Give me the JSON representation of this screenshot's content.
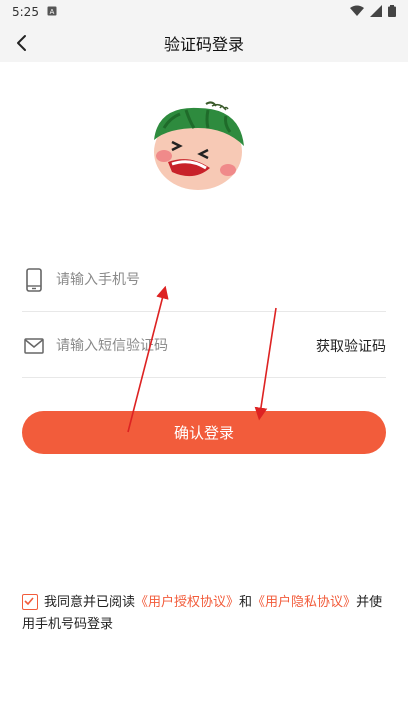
{
  "status_bar": {
    "time": "5:25",
    "notification_icon": "a-icon",
    "wifi_icon": "wifi-icon",
    "signal_icon": "signal-icon",
    "battery_icon": "battery-icon"
  },
  "app_bar": {
    "back_icon": "chevron-left-icon",
    "title": "验证码登录"
  },
  "avatar": {
    "icon": "watermelon-face-icon"
  },
  "phone_field": {
    "icon": "phone-icon",
    "placeholder": "请输入手机号",
    "value": ""
  },
  "code_field": {
    "icon": "mail-icon",
    "placeholder": "请输入短信验证码",
    "value": "",
    "get_code_label": "获取验证码"
  },
  "login_button": {
    "label": "确认登录"
  },
  "agreement": {
    "checked": true,
    "text_1": "我同意并已阅读",
    "link_1": "《用户授权协议》",
    "text_2": "和",
    "link_2": "《用户隐私协议》",
    "text_3": "并使用手机号码登录"
  },
  "colors": {
    "accent": "#f25c3b",
    "bar_bg": "#f4f4f4",
    "divider": "#e8e8e8"
  }
}
